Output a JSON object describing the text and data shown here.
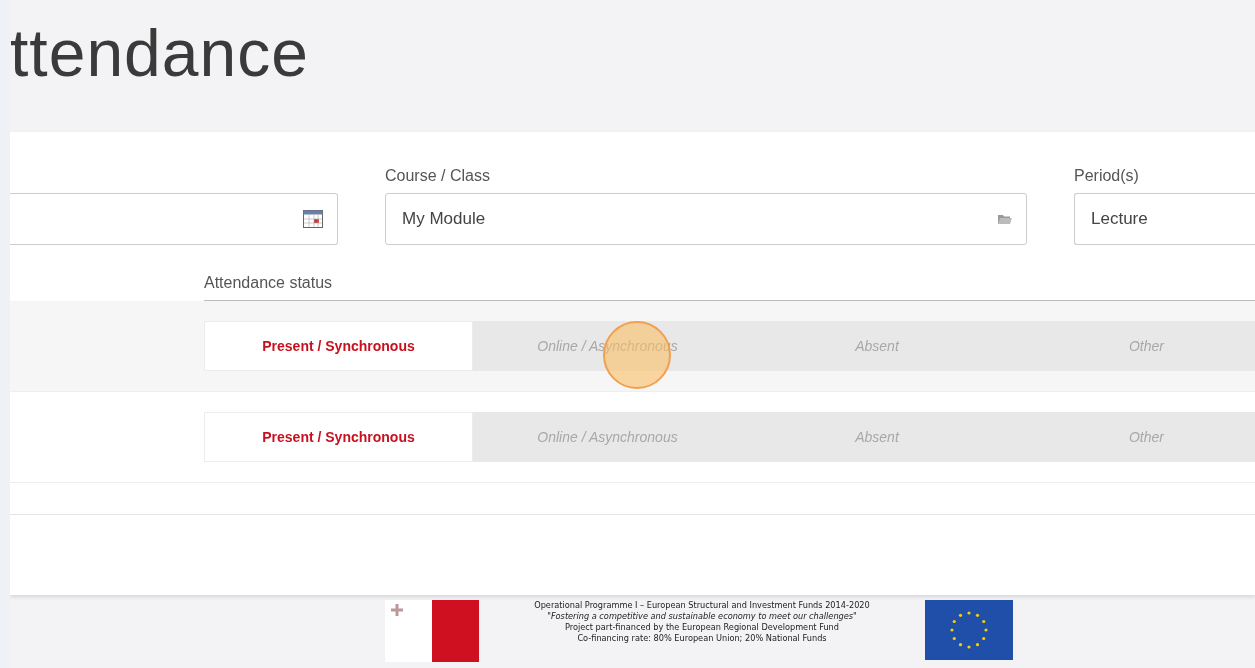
{
  "title": "ttendance",
  "filters": [
    {
      "kind": "date"
    },
    {
      "kind": "select",
      "label": "Course / Class",
      "value": "My Module"
    },
    {
      "kind": "text",
      "label": "Period(s)",
      "value": "Lecture"
    }
  ],
  "status_header": "Attendance status",
  "rows": [
    {
      "options": [
        {
          "label": "Present / Synchronous",
          "selected": true,
          "click_marker": false
        },
        {
          "label": "Online / Asynchronous",
          "selected": false,
          "click_marker": true
        },
        {
          "label": "Absent",
          "selected": false,
          "click_marker": false
        },
        {
          "label": "Other",
          "selected": false,
          "click_marker": false
        }
      ]
    },
    {
      "options": [
        {
          "label": "Present / Synchronous",
          "selected": true,
          "click_marker": false
        },
        {
          "label": "Online / Asynchronous",
          "selected": false,
          "click_marker": false
        },
        {
          "label": "Absent",
          "selected": false,
          "click_marker": false
        },
        {
          "label": "Other",
          "selected": false,
          "click_marker": false
        }
      ]
    }
  ],
  "footer": {
    "lines": [
      "Operational Programme I – European Structural and Investment Funds 2014-2020",
      "\"Fostering a competitive and sustainable economy to meet our challenges\"",
      "Project part-financed by the European Regional Development Fund",
      "Co-financing rate: 80% European Union; 20% National Funds"
    ]
  }
}
